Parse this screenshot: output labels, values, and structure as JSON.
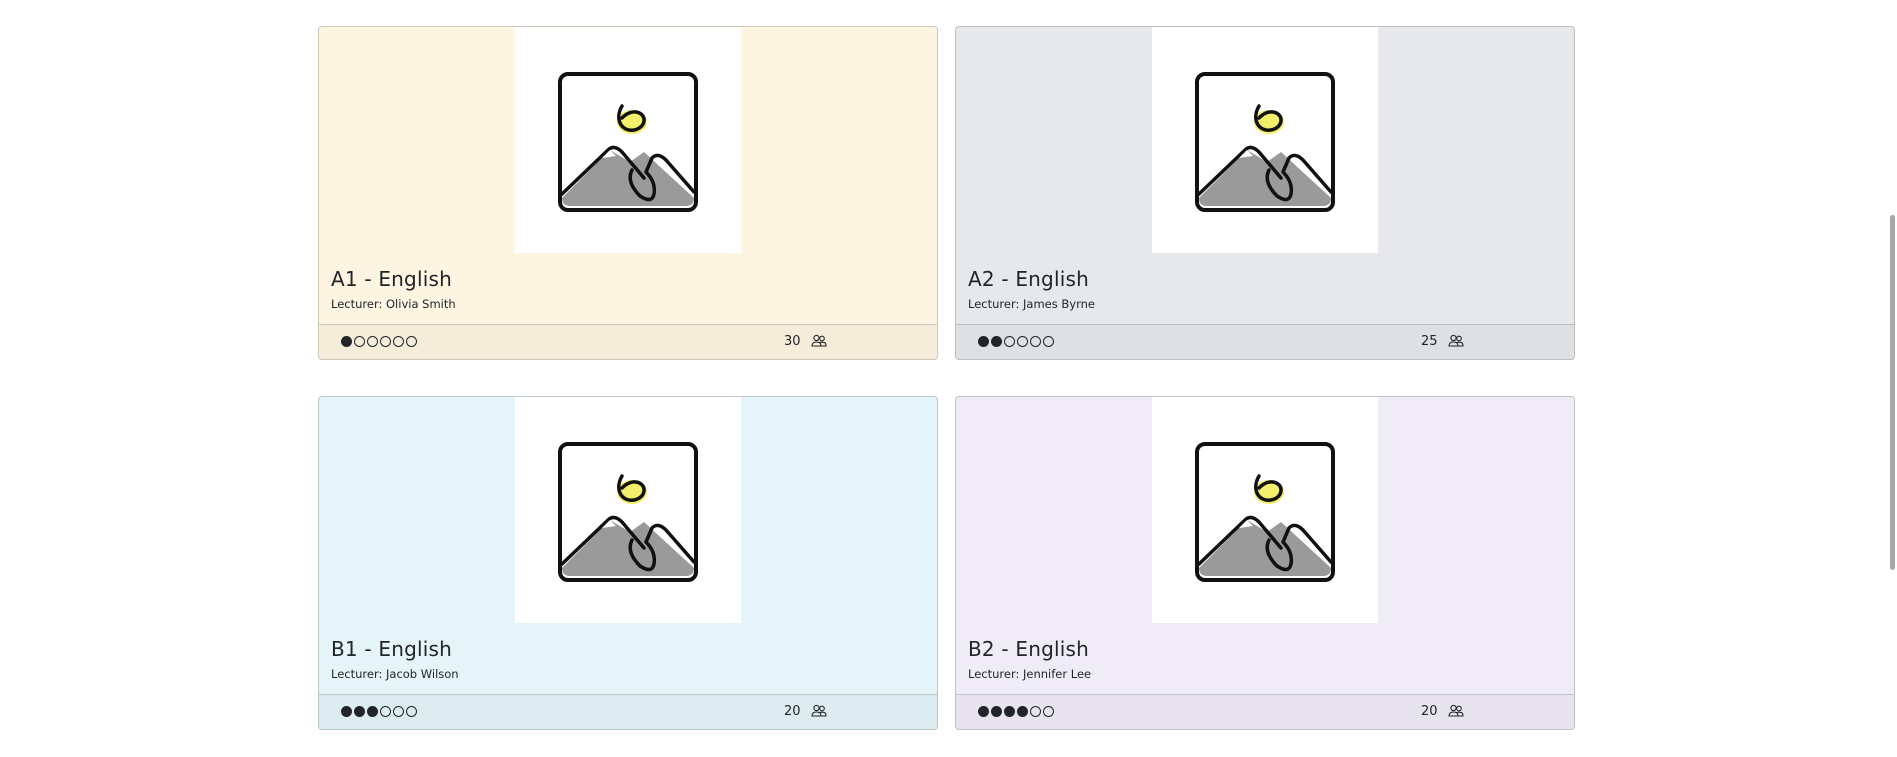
{
  "courses": [
    {
      "title": "A1 - English",
      "lecturer": "Lecturer: Olivia Smith",
      "level": 1,
      "max_level": 6,
      "students": "30",
      "background": "#fdf5e2"
    },
    {
      "title": "A2 - English",
      "lecturer": "Lecturer: James Byrne",
      "level": 2,
      "max_level": 6,
      "students": "25",
      "background": "#e6e8eb"
    },
    {
      "title": "B1 - English",
      "lecturer": "Lecturer: Jacob Wilson",
      "level": 3,
      "max_level": 6,
      "students": "20",
      "background": "#e4f4f8"
    },
    {
      "title": "B2 - English",
      "lecturer": "Lecturer: Jennifer Lee",
      "level": 4,
      "max_level": 6,
      "students": "20",
      "background": "#efecf8"
    }
  ],
  "icons": {
    "course_image": "image-placeholder-icon",
    "students": "people-icon"
  }
}
